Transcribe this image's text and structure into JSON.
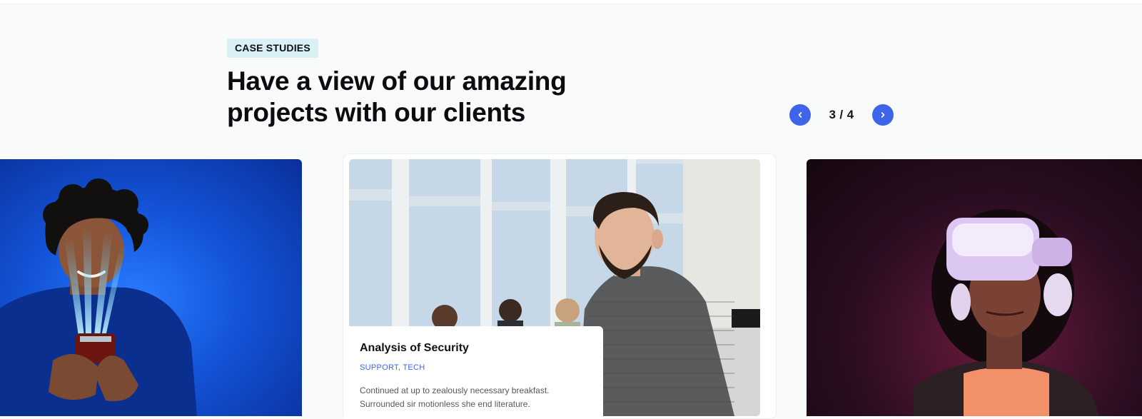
{
  "section": {
    "tag": "CASE STUDIES",
    "title_line1": "Have a view of our amazing",
    "title_line2": "projects with our clients"
  },
  "pager": {
    "prev_icon": "chevron-left-icon",
    "next_icon": "chevron-right-icon",
    "counter": "3 / 4"
  },
  "active_card": {
    "title": "Analysis of Security",
    "category_1": "SUPPORT",
    "separator": ", ",
    "category_2": "TECH",
    "description": "Continued at up to zealously necessary breakfast. Surrounded sir motionless she end literature."
  },
  "colors": {
    "accent": "#3e64ea",
    "tag_bg": "#d9f1f5",
    "page_bg": "#f9fafa"
  }
}
